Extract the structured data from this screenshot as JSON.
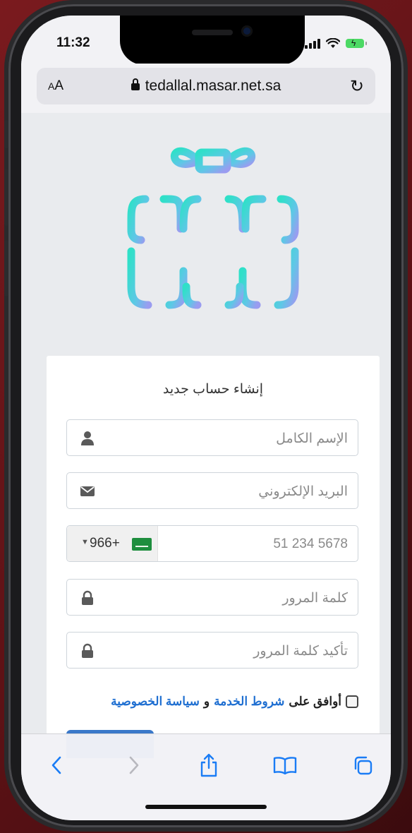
{
  "status": {
    "time": "11:32"
  },
  "browser": {
    "text_size_label_small": "A",
    "text_size_label_large": "A",
    "url": "tedallal.masar.net.sa"
  },
  "form": {
    "title": "إنشاء حساب جديد",
    "full_name_placeholder": "الإسم الكامل",
    "email_placeholder": "البريد الإلكتروني",
    "phone_country_code": "966+",
    "phone_placeholder": "5678 234 51",
    "password_placeholder": "كلمة المرور",
    "confirm_password_placeholder": "تأكيد كلمة المرور",
    "terms": {
      "prefix": "أوافق على",
      "terms_link": "شروط الخدمة",
      "and": "و",
      "privacy_link": "سياسة الخصوصية"
    }
  },
  "toolbar": {
    "icons": [
      "back-icon",
      "forward-icon",
      "share-icon",
      "bookmarks-icon",
      "tabs-icon"
    ]
  },
  "colors": {
    "link": "#1f6fd1",
    "submit": "#3a78c9",
    "logo_cyan": "#3ed6cc",
    "logo_blue": "#8aa0ee"
  }
}
